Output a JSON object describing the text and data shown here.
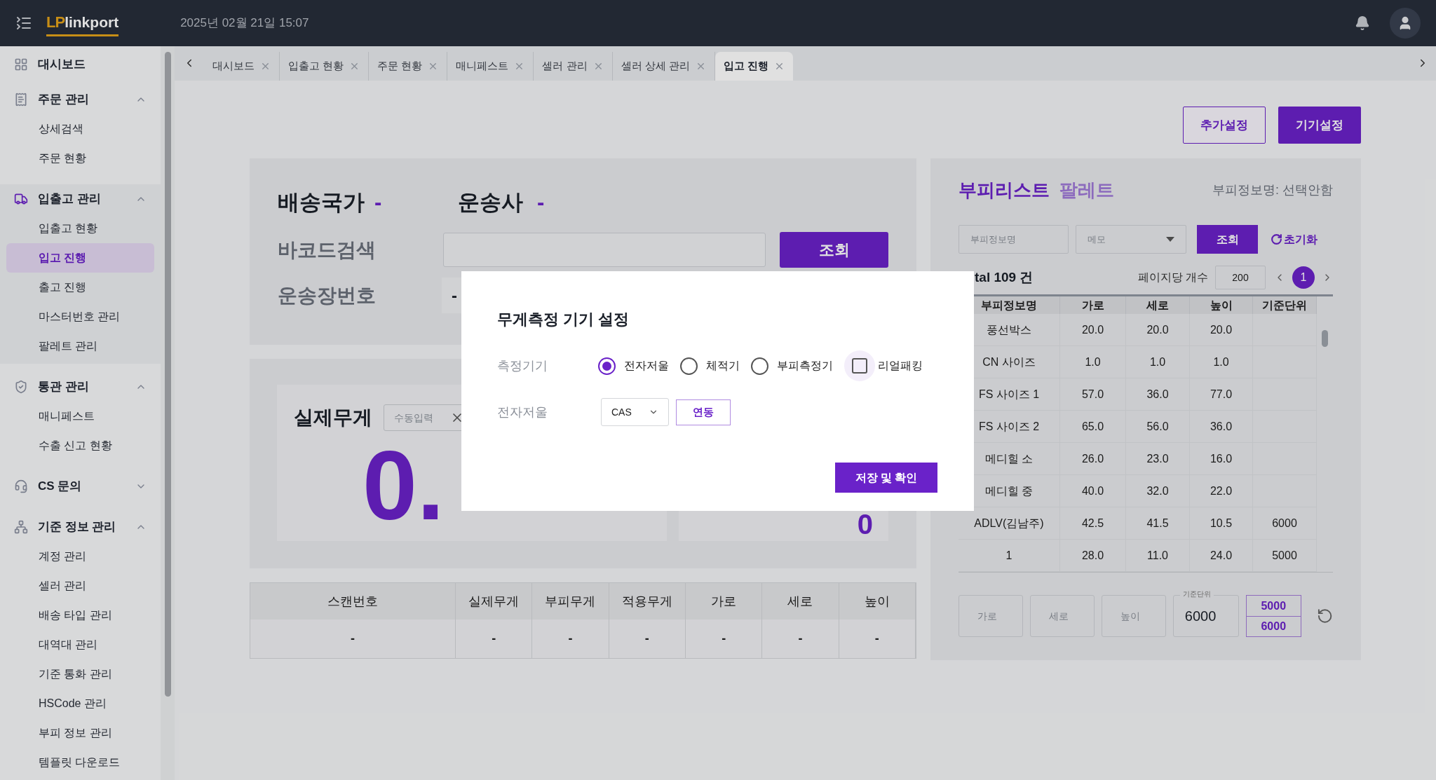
{
  "header": {
    "logo_mark": "LP",
    "logo_text": "linkport",
    "datetime": "2025년 02월 21일 15:07"
  },
  "sidebar": {
    "items": [
      {
        "kind": "link",
        "label": "대시보드",
        "selected": false
      },
      {
        "kind": "group",
        "label": "주문 관리",
        "active": false,
        "expanded": true,
        "children": [
          {
            "label": "상세검색",
            "selected": false
          },
          {
            "label": "주문 현황",
            "selected": false
          }
        ]
      },
      {
        "kind": "group",
        "label": "입출고 관리",
        "active": true,
        "expanded": true,
        "children": [
          {
            "label": "입출고 현황",
            "selected": false
          },
          {
            "label": "입고 진행",
            "selected": true
          },
          {
            "label": "출고 진행",
            "selected": false
          },
          {
            "label": "마스터번호 관리",
            "selected": false
          },
          {
            "label": "팔레트 관리",
            "selected": false
          }
        ]
      },
      {
        "kind": "group",
        "label": "통관 관리",
        "active": false,
        "expanded": true,
        "children": [
          {
            "label": "매니페스트",
            "selected": false
          },
          {
            "label": "수출 신고 현황",
            "selected": false
          }
        ]
      },
      {
        "kind": "group",
        "label": "CS 문의",
        "active": false,
        "expanded": false
      },
      {
        "kind": "group",
        "label": "기준 정보 관리",
        "active": false,
        "expanded": true,
        "children": [
          {
            "label": "계정 관리",
            "selected": false
          },
          {
            "label": "셀러 관리",
            "selected": false
          },
          {
            "label": "배송 타입 관리",
            "selected": false
          },
          {
            "label": "대역대 관리",
            "selected": false
          },
          {
            "label": "기준 통화 관리",
            "selected": false
          },
          {
            "label": "HSCode 관리",
            "selected": false
          },
          {
            "label": "부피 정보 관리",
            "selected": false
          },
          {
            "label": "템플릿 다운로드",
            "selected": false
          }
        ]
      }
    ]
  },
  "tabs": [
    {
      "label": "대시보드",
      "selected": false
    },
    {
      "label": "입출고 현황",
      "selected": false
    },
    {
      "label": "주문 현황",
      "selected": false
    },
    {
      "label": "매니페스트",
      "selected": false
    },
    {
      "label": "셀러 관리",
      "selected": false
    },
    {
      "label": "셀러 상세 관리",
      "selected": false
    },
    {
      "label": "입고 진행",
      "selected": true
    }
  ],
  "actions": [
    {
      "label": "추가설정",
      "kind": "outline"
    },
    {
      "label": "기기설정",
      "kind": "primary"
    }
  ],
  "scan_panel": {
    "country_label": "배송국가",
    "country_value": "-",
    "carrier_label": "운송사",
    "carrier_value": "-",
    "barcode_label": "바코드검색",
    "search_button": "조회",
    "waybill_label": "운송장번호",
    "waybill_value": "-"
  },
  "weight_panel": {
    "label": "실제무게",
    "input_placeholder": "수동입력",
    "value": "0.",
    "side_value": "0"
  },
  "scan_table": {
    "columns": [
      "스캔번호",
      "실제무게",
      "부피무게",
      "적용무게",
      "가로",
      "세로",
      "높이"
    ],
    "rows": [
      [
        "-",
        "-",
        "-",
        "-",
        "-",
        "-",
        "-"
      ]
    ]
  },
  "volume_panel": {
    "title_tabs": [
      {
        "label": "부피리스트",
        "selected": true
      },
      {
        "label": "팔레트",
        "selected": false
      }
    ],
    "selection_info": "부피정보명: 선택안함",
    "name_placeholder": "부피정보명",
    "memo_placeholder": "메모",
    "search_button": "조회",
    "reset_button": "초기화",
    "total": "tal 109 건",
    "page_size_label": "페이지당 개수",
    "page_size": "200",
    "pages": [
      {
        "label": "1",
        "selected": true
      }
    ],
    "columns": [
      "부피정보명",
      "가로",
      "세로",
      "높이",
      "기준단위"
    ],
    "rows": [
      [
        "풍선박스",
        "20.0",
        "20.0",
        "20.0",
        ""
      ],
      [
        "CN 사이즈",
        "1.0",
        "1.0",
        "1.0",
        ""
      ],
      [
        "FS 사이즈 1",
        "57.0",
        "36.0",
        "77.0",
        ""
      ],
      [
        "FS 사이즈 2",
        "65.0",
        "56.0",
        "36.0",
        ""
      ],
      [
        "메디힐 소",
        "26.0",
        "23.0",
        "16.0",
        ""
      ],
      [
        "메디힐 중",
        "40.0",
        "32.0",
        "22.0",
        ""
      ],
      [
        "ADLV(김남주)",
        "42.5",
        "41.5",
        "10.5",
        "6000"
      ],
      [
        "1",
        "28.0",
        "11.0",
        "24.0",
        "5000"
      ]
    ],
    "width_placeholder": "가로",
    "depth_placeholder": "세로",
    "height_placeholder": "높이",
    "unit_label": "기준단위",
    "unit_value": "6000",
    "unit_options": [
      "5000",
      "6000"
    ]
  },
  "modal": {
    "title": "무게측정 기기 설정",
    "device_label": "측정기기",
    "options": [
      {
        "label": "전자저울",
        "kind": "radio",
        "selected": true
      },
      {
        "label": "체적기",
        "kind": "radio",
        "selected": false
      },
      {
        "label": "부피측정기",
        "kind": "radio",
        "selected": false
      },
      {
        "label": "리얼패킹",
        "kind": "checkbox",
        "checked": false
      }
    ],
    "scale_label": "전자저울",
    "scale_model": "CAS",
    "link_button": "연동",
    "save_button": "저장 및 확인"
  }
}
